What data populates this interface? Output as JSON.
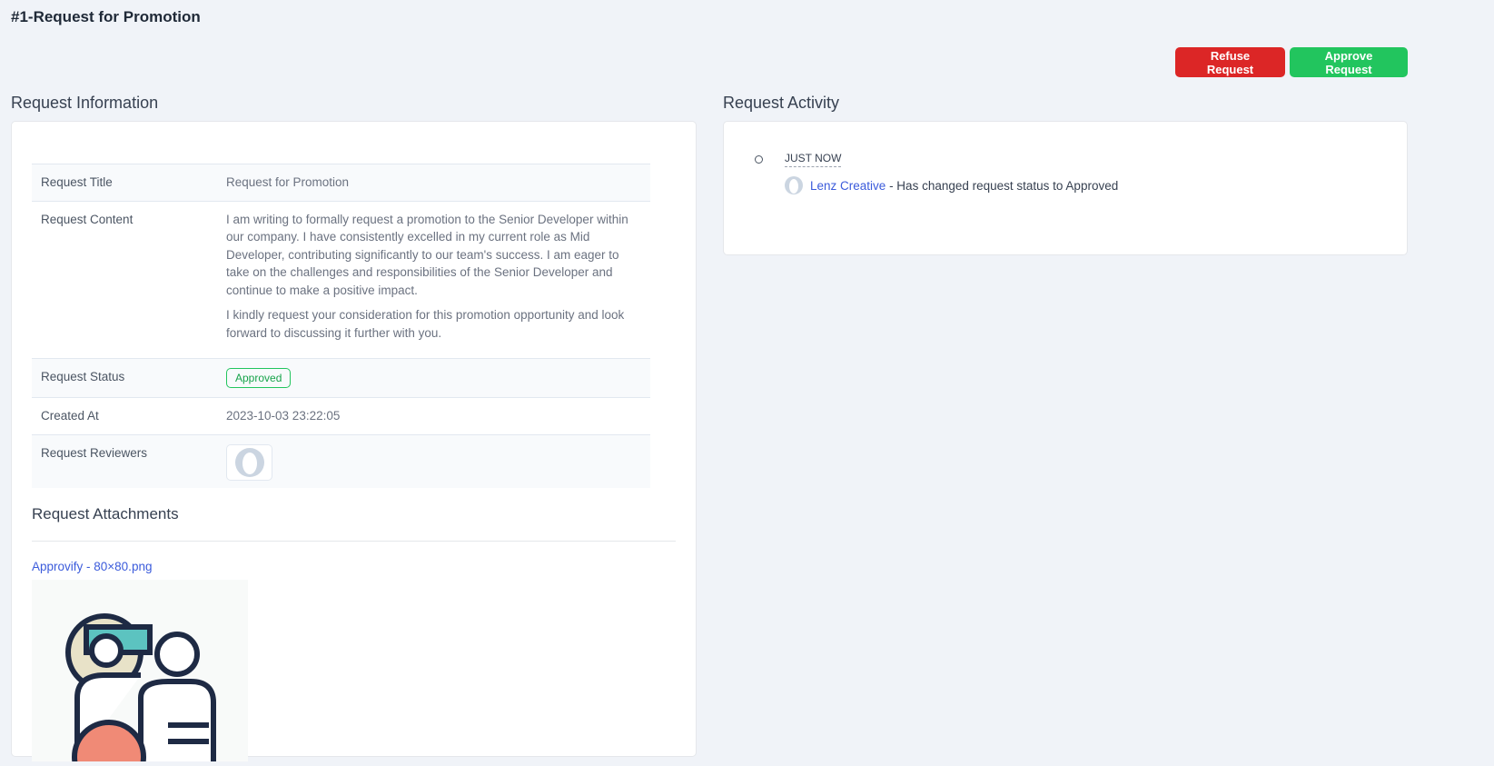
{
  "page": {
    "title": "#1-Request for Promotion"
  },
  "actions": {
    "refuse": "Refuse Request",
    "approve": "Approve Request"
  },
  "info": {
    "section_title": "Request Information",
    "rows": [
      {
        "label": "Request Title",
        "value": "Request for Promotion"
      },
      {
        "label": "Request Content",
        "paragraphs": [
          "I am writing to formally request a promotion to the Senior Developer within our company. I have consistently excelled in my current role as Mid Developer, contributing significantly to our team's success. I am eager to take on the challenges and responsibilities of the Senior Developer and continue to make a positive impact.",
          "I kindly request your consideration for this promotion opportunity and look forward to discussing it further with you."
        ]
      },
      {
        "label": "Request Status",
        "value": "Approved"
      },
      {
        "label": "Created At",
        "value": "2023-10-03 23:22:05"
      },
      {
        "label": "Request Reviewers"
      }
    ]
  },
  "attachments": {
    "title": "Request Attachments",
    "items": [
      {
        "name": "Approvify - 80×80.png"
      }
    ]
  },
  "activity": {
    "section_title": "Request Activity",
    "items": [
      {
        "when": "JUST NOW",
        "user": "Lenz Creative",
        "text": "- Has changed request status to Approved"
      }
    ]
  }
}
